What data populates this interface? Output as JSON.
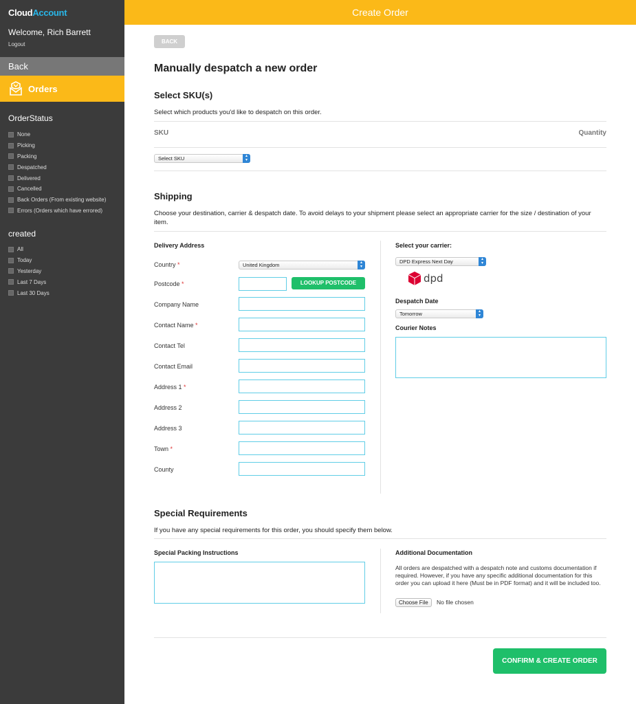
{
  "sidebar": {
    "logo_part1": "Cloud",
    "logo_part2": "Account",
    "welcome": "Welcome, Rich Barrett",
    "logout": "Logout",
    "back": "Back",
    "orders": "Orders",
    "order_status_heading": "OrderStatus",
    "order_status": [
      "None",
      "Picking",
      "Packing",
      "Despatched",
      "Delivered",
      "Cancelled",
      "Back Orders (From existing website)",
      "Errors (Orders which have errored)"
    ],
    "created_heading": "created",
    "created": [
      "All",
      "Today",
      "Yesterday",
      "Last 7 Days",
      "Last 30 Days"
    ]
  },
  "header": {
    "title": "Create Order"
  },
  "main": {
    "back_button": "BACK",
    "title": "Manually despatch a new order",
    "sku": {
      "heading": "Select SKU(s)",
      "description": "Select which products you'd like to despatch on this order.",
      "col_sku": "SKU",
      "col_quantity": "Quantity",
      "select_value": "Select SKU"
    },
    "shipping": {
      "heading": "Shipping",
      "description": "Choose your destination, carrier & despatch date. To avoid delays to your shipment please select an appropriate carrier for the size / destination of your item.",
      "delivery_address": "Delivery Address",
      "labels": {
        "country": "Country",
        "postcode": "Postcode",
        "company": "Company Name",
        "contact_name": "Contact Name",
        "contact_tel": "Contact Tel",
        "contact_email": "Contact Email",
        "address1": "Address 1",
        "address2": "Address 2",
        "address3": "Address 3",
        "town": "Town",
        "county": "County"
      },
      "required_mark": "*",
      "country_value": "United Kingdom",
      "lookup_button": "LOOKUP POSTCODE",
      "carrier_heading": "Select your carrier:",
      "carrier_value": "DPD Express Next Day",
      "carrier_logo_text": "dpd",
      "despatch_date_heading": "Despatch Date",
      "despatch_date_value": "Tomorrow",
      "courier_notes_heading": "Courier Notes"
    },
    "special": {
      "heading": "Special Requirements",
      "description": "If you have any special requirements for this order, you should specify them below.",
      "packing_heading": "Special Packing Instructions",
      "docs_heading": "Additional Documentation",
      "docs_text": "All orders are despatched with a despatch note and customs documentation if required. However, if you have any specific additional documentation for this order you can upload it here (Must be in PDF format) and it will be included too.",
      "choose_file": "Choose File",
      "no_file": "No file chosen"
    },
    "confirm_button": "CONFIRM & CREATE ORDER"
  },
  "colors": {
    "accent": "#fbb918",
    "sidebar": "#3b3b3b",
    "green": "#1fbf6a",
    "field_border": "#5fcde6",
    "dpd_red": "#dc0032"
  }
}
